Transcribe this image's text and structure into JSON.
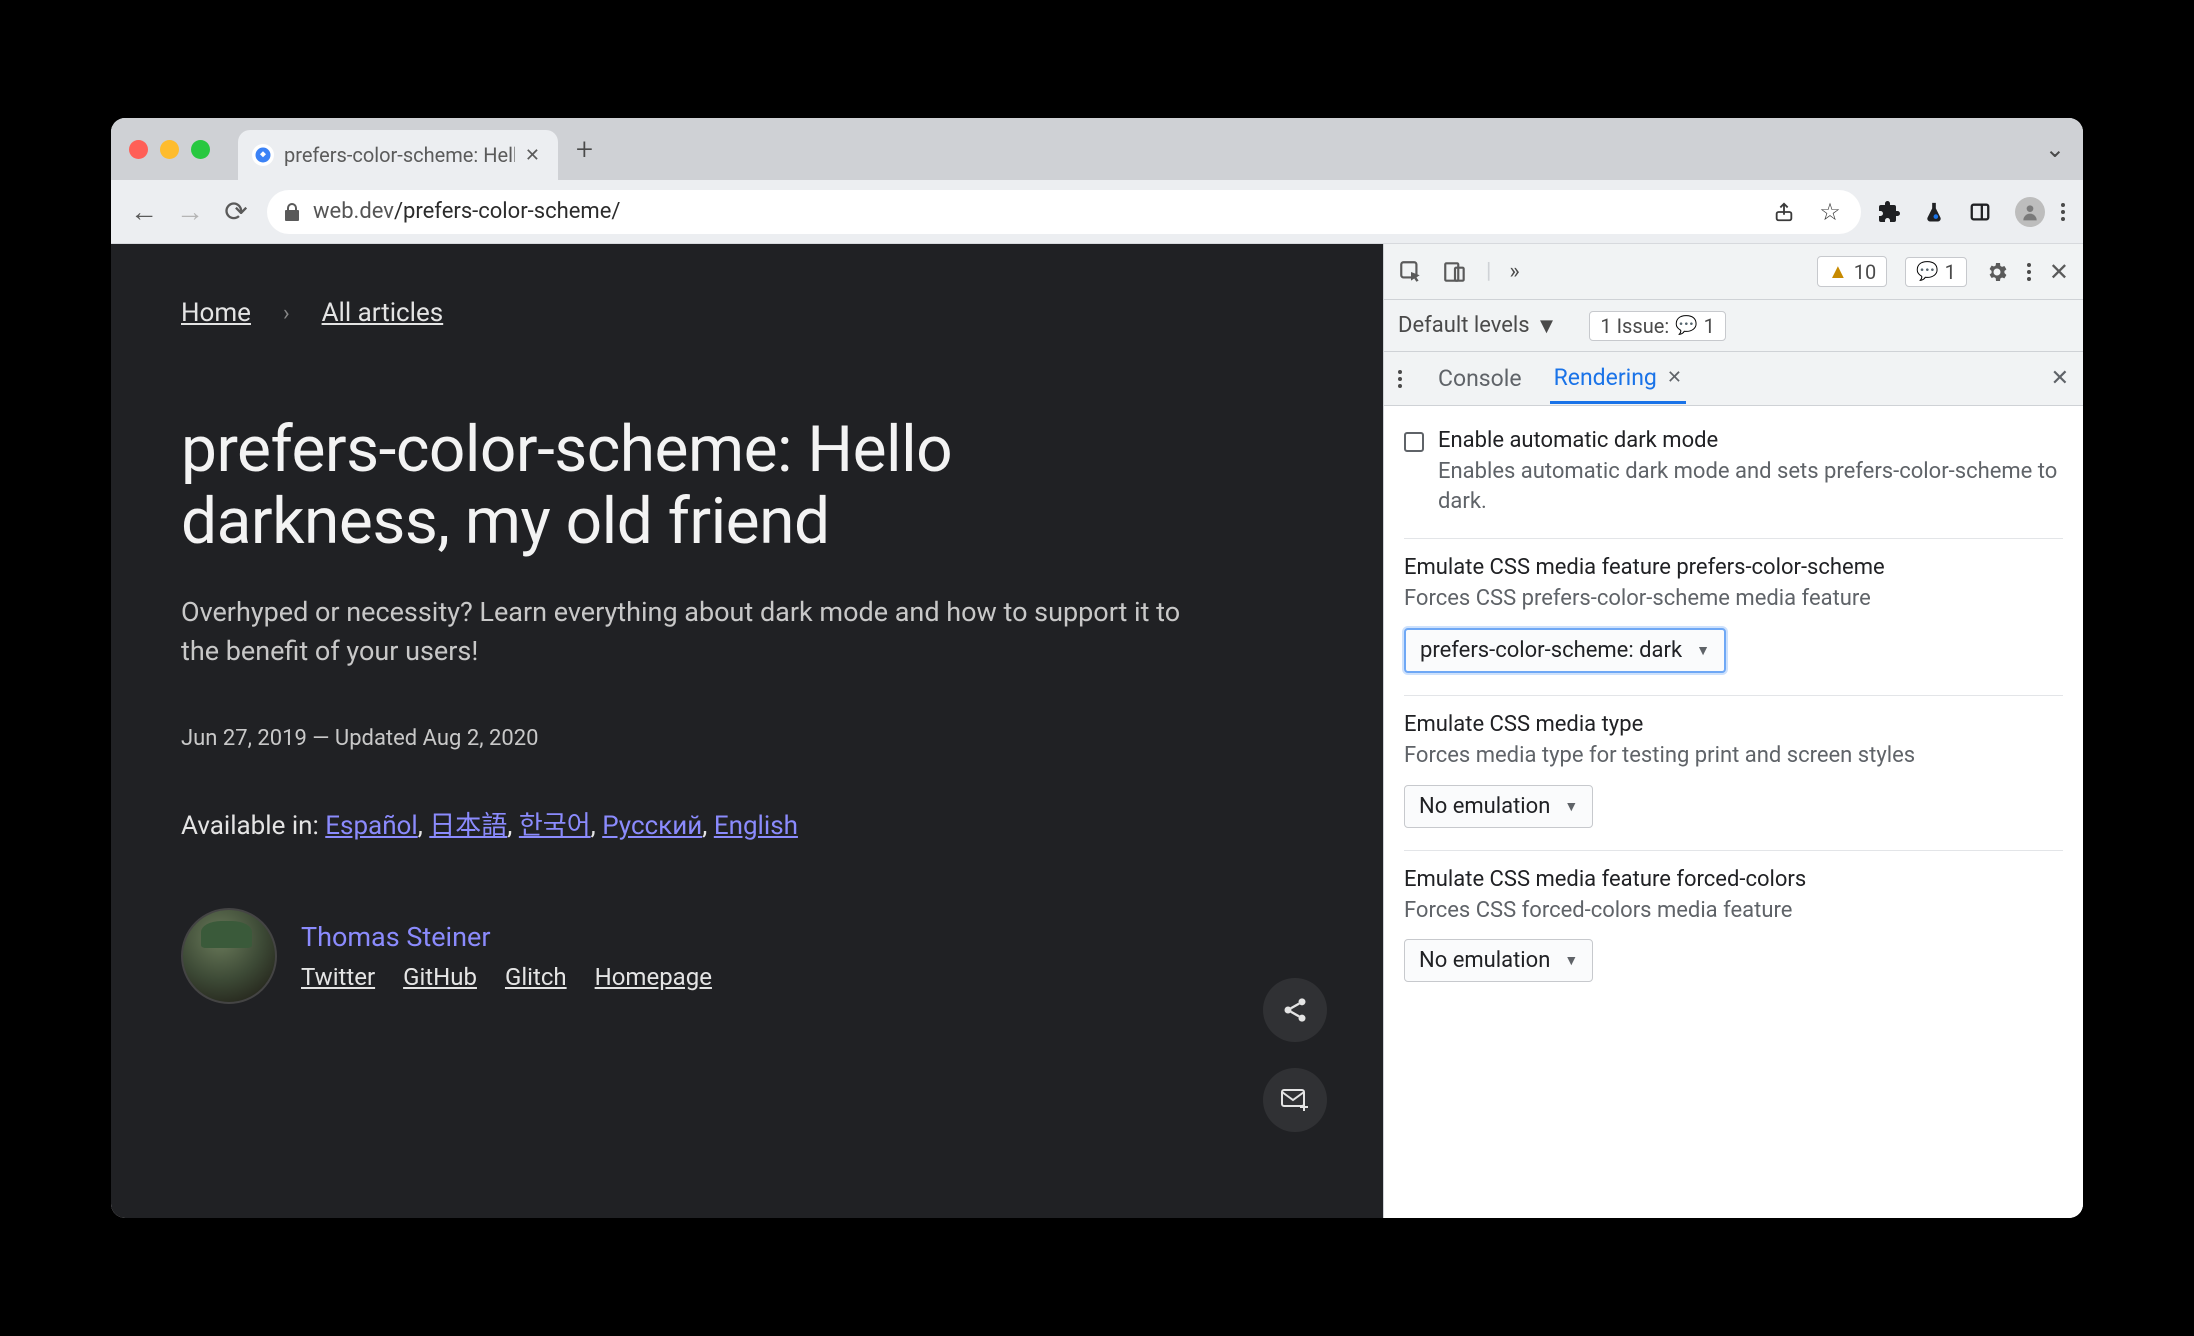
{
  "tab": {
    "title": "prefers-color-scheme: Hello da",
    "favicon_emoji": "🌐"
  },
  "omnibox": {
    "host": "web.dev",
    "path": "/prefers-color-scheme/"
  },
  "page": {
    "breadcrumb": {
      "home": "Home",
      "all": "All articles"
    },
    "title": "prefers-color-scheme: Hello darkness, my old friend",
    "subtitle": "Overhyped or necessity? Learn everything about dark mode and how to support it to the benefit of your users!",
    "dates": "Jun 27, 2019 — Updated Aug 2, 2020",
    "langs_label": "Available in:",
    "langs": {
      "es": "Español",
      "ja": "日本語",
      "ko": "한국어",
      "ru": "Русский",
      "en": "English"
    },
    "author": {
      "name": "Thomas Steiner",
      "links": {
        "twitter": "Twitter",
        "github": "GitHub",
        "glitch": "Glitch",
        "homepage": "Homepage"
      }
    }
  },
  "devtools": {
    "badges": {
      "warn_count": "10",
      "issue_count": "1"
    },
    "filter": {
      "levels": "Default levels",
      "issues_label": "1 Issue:",
      "issues_count": "1"
    },
    "tabs": {
      "console": "Console",
      "rendering": "Rendering"
    },
    "rendering": {
      "auto_dark": {
        "label": "Enable automatic dark mode",
        "desc": "Enables automatic dark mode and sets prefers-color-scheme to dark."
      },
      "prefers_scheme": {
        "label": "Emulate CSS media feature prefers-color-scheme",
        "desc": "Forces CSS prefers-color-scheme media feature",
        "value": "prefers-color-scheme: dark"
      },
      "media_type": {
        "label": "Emulate CSS media type",
        "desc": "Forces media type for testing print and screen styles",
        "value": "No emulation"
      },
      "forced_colors": {
        "label": "Emulate CSS media feature forced-colors",
        "desc": "Forces CSS forced-colors media feature",
        "value": "No emulation"
      }
    }
  }
}
